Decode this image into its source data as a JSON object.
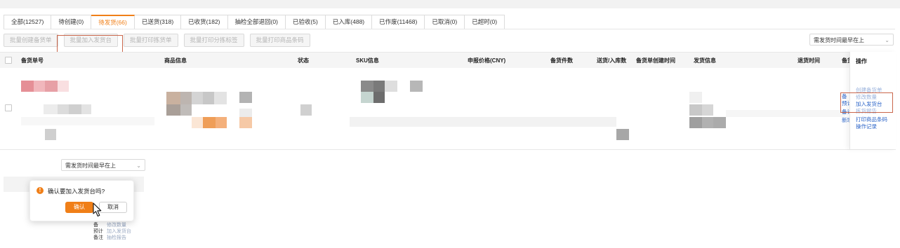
{
  "tabs": [
    {
      "label": "全部(12527)"
    },
    {
      "label": "待创建(0)"
    },
    {
      "label": "待发货(66)"
    },
    {
      "label": "已送货(318)"
    },
    {
      "label": "已收货(182)"
    },
    {
      "label": "抽检全部退回(0)"
    },
    {
      "label": "已验收(5)"
    },
    {
      "label": "已入库(488)"
    },
    {
      "label": "已作废(11468)"
    },
    {
      "label": "已取消(0)"
    },
    {
      "label": "已超时(0)"
    }
  ],
  "bulk": [
    {
      "label": "批量创建备货单"
    },
    {
      "label": "批量加入发货台"
    },
    {
      "label": "批量打印拣货单"
    },
    {
      "label": "批量打印分拣标签"
    },
    {
      "label": "批量打印商品条码"
    }
  ],
  "sort": {
    "label": "需发货时间最早在上",
    "label2": "需发货时间最早在上"
  },
  "columns": {
    "order_no": "备货单号",
    "goods": "商品信息",
    "status": "状态",
    "sku": "SKU信息",
    "price": "申报价格(CNY)",
    "qty": "备货件数",
    "delivered": "送货/入库数",
    "created": "备货单创建时间",
    "ship_info": "发货信息",
    "return_time": "退货时间",
    "clipped_header": "备货",
    "ops": "操作"
  },
  "ops": [
    {
      "label": "创建备货单"
    },
    {
      "label": "修改数量"
    },
    {
      "label": "加入发货台"
    },
    {
      "label": "拣货报告"
    },
    {
      "label": "打印商品条码"
    },
    {
      "label": "操作记录"
    }
  ],
  "clipped_col": [
    "备",
    "预计",
    "备计",
    "新增"
  ],
  "dialog": {
    "title": "确认要加入发货台吗?",
    "confirm": "确认",
    "cancel": "取消"
  },
  "bg_ops": [
    "修改数量",
    "加入发货台",
    "抽检报告"
  ],
  "bg_left": [
    "备",
    "预计",
    "备注"
  ],
  "colors": {
    "accent": "#f07f18",
    "link": "#2b64c8",
    "highlight_box": "#c9664b"
  }
}
